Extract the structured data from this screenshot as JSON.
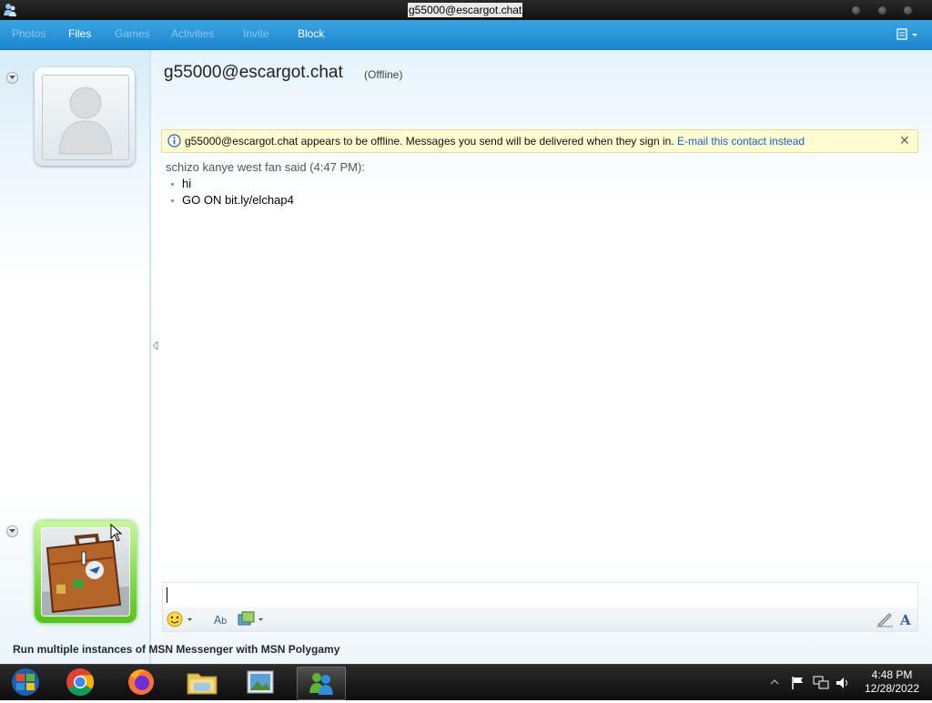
{
  "window": {
    "title": "g55000@escargot.chat"
  },
  "menu": {
    "photos": "Photos",
    "files": "Files",
    "games": "Games",
    "activities": "Activities",
    "invite": "Invite",
    "block": "Block"
  },
  "contact": {
    "name": "g55000@escargot.chat",
    "status": "(Offline)"
  },
  "infobar": {
    "message": "g55000@escargot.chat appears to be offline. Messages you send will be delivered when they sign in.",
    "link": "E-mail this contact instead",
    "close": "✕"
  },
  "conversation": {
    "header": "schizo kanye west fan said (4:47 PM):",
    "messages": [
      "hi",
      "GO ON bit.ly/elchap4"
    ]
  },
  "input": {
    "value": ""
  },
  "status_tip": "Run multiple instances of MSN Messenger with MSN Polygamy",
  "taskbar": {
    "apps": [
      "start-orb-icon",
      "chrome-icon",
      "firefox-icon",
      "file-explorer-icon",
      "image-viewer-icon",
      "messenger-icon"
    ],
    "time": "4:48 PM",
    "date": "12/28/2022"
  },
  "colors": {
    "menubar": "#2a97da",
    "accent_green": "#55c21a",
    "link": "#1b5fc0",
    "infobar_bg": "#fefcd0"
  }
}
